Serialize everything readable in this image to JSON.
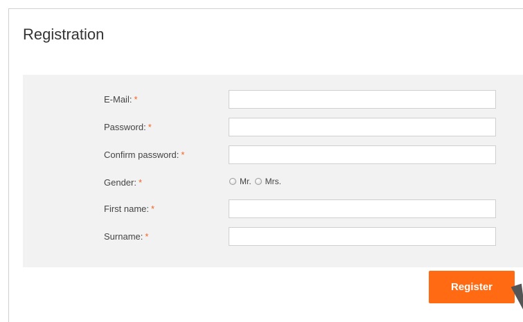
{
  "form": {
    "title": "Registration",
    "required_marker": "*",
    "fields": {
      "email": {
        "label": "E-Mail:",
        "value": ""
      },
      "password": {
        "label": "Password:",
        "value": ""
      },
      "confirm_password": {
        "label": "Confirm password:",
        "value": ""
      },
      "gender": {
        "label": "Gender:",
        "options": [
          "Mr.",
          "Mrs."
        ],
        "selected": ""
      },
      "first_name": {
        "label": "First name:",
        "value": ""
      },
      "surname": {
        "label": "Surname:",
        "value": ""
      }
    },
    "submit_label": "Register"
  },
  "colors": {
    "accent": "#ff6a13",
    "required": "#f26322",
    "panel_bg": "#f2f2f2"
  }
}
